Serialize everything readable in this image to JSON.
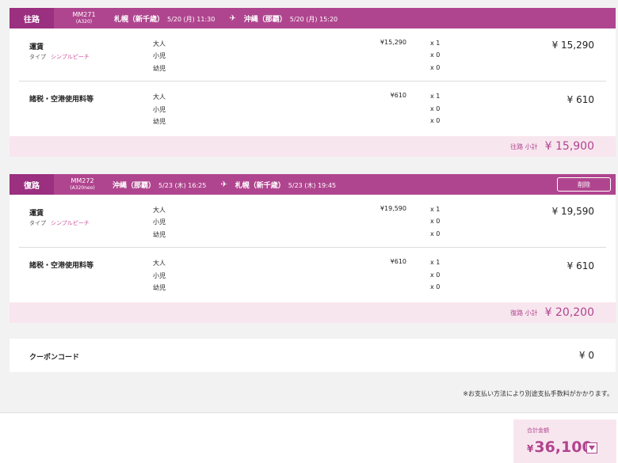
{
  "outbound": {
    "tag": "往路",
    "flight_no": "MM271",
    "aircraft": "(A320)",
    "dep_city": "札幌（新千歳）",
    "dep_time": "5/20 (月) 11:30",
    "arr_city": "沖縄（那覇）",
    "arr_time": "5/20 (月) 15:20",
    "fare": {
      "title": "運賃",
      "type_label": "タイプ",
      "type_value": "シンプルピーチ",
      "rows": [
        {
          "pax": "大人",
          "unit": "¥15,290",
          "qty": "x 1"
        },
        {
          "pax": "小児",
          "unit": "",
          "qty": "x 0"
        },
        {
          "pax": "幼児",
          "unit": "",
          "qty": "x 0"
        }
      ],
      "total": "¥ 15,290"
    },
    "tax": {
      "title": "諸税・空港使用料等",
      "rows": [
        {
          "pax": "大人",
          "unit": "¥610",
          "qty": "x 1"
        },
        {
          "pax": "小児",
          "unit": "",
          "qty": "x 0"
        },
        {
          "pax": "幼児",
          "unit": "",
          "qty": "x 0"
        }
      ],
      "total": "¥ 610"
    },
    "subtotal_label": "往路 小計",
    "subtotal": "¥ 15,900"
  },
  "return": {
    "tag": "復路",
    "flight_no": "MM272",
    "aircraft": "(A320neo)",
    "dep_city": "沖縄（那覇）",
    "dep_time": "5/23 (木) 16:25",
    "arr_city": "札幌（新千歳）",
    "arr_time": "5/23 (木) 19:45",
    "delete_label": "削除",
    "fare": {
      "title": "運賃",
      "type_label": "タイプ",
      "type_value": "シンプルピーチ",
      "rows": [
        {
          "pax": "大人",
          "unit": "¥19,590",
          "qty": "x 1"
        },
        {
          "pax": "小児",
          "unit": "",
          "qty": "x 0"
        },
        {
          "pax": "幼児",
          "unit": "",
          "qty": "x 0"
        }
      ],
      "total": "¥ 19,590"
    },
    "tax": {
      "title": "諸税・空港使用料等",
      "rows": [
        {
          "pax": "大人",
          "unit": "¥610",
          "qty": "x 1"
        },
        {
          "pax": "小児",
          "unit": "",
          "qty": "x 0"
        },
        {
          "pax": "幼児",
          "unit": "",
          "qty": "x 0"
        }
      ],
      "total": "¥ 610"
    },
    "subtotal_label": "復路 小計",
    "subtotal": "¥ 20,200"
  },
  "coupon": {
    "label": "クーポンコード",
    "amount": "¥ 0"
  },
  "note": "※お支払い方法により別途支払手数料がかかります。",
  "grand_total": {
    "label": "合計金額",
    "currency": "¥",
    "amount": "36,100"
  },
  "colors": {
    "accent": "#b0458f",
    "accent_dark": "#9b2f80",
    "subtotal_bg": "#f8e6ef",
    "type_value": "#d0559f"
  },
  "icons": {
    "plane": "airplane-icon",
    "expand": "chevron-down-icon"
  }
}
